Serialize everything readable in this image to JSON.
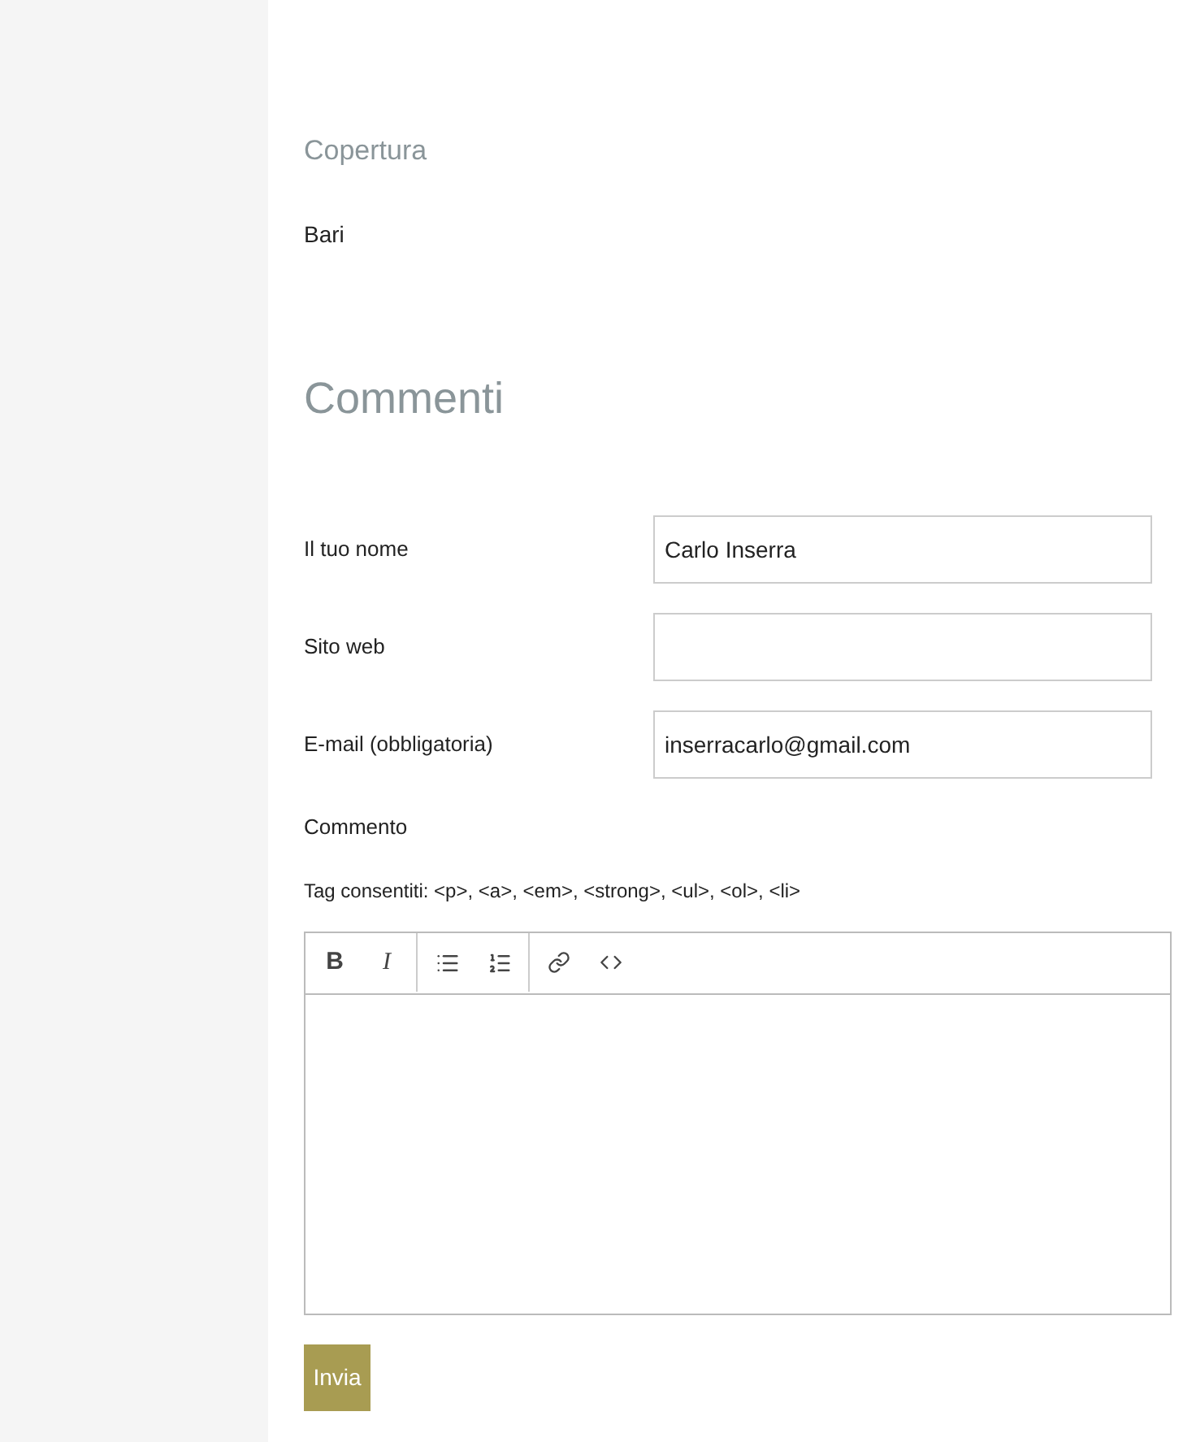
{
  "coverage": {
    "heading": "Copertura",
    "value": "Bari"
  },
  "comments": {
    "heading": "Commenti",
    "fields": [
      {
        "label": "Il tuo nome",
        "value": "Carlo Inserra"
      },
      {
        "label": "Sito web"
      },
      {
        "label": "E-mail (obbligatoria)",
        "value": "inserracarlo@gmail.com"
      }
    ],
    "comment_label": "Commento",
    "allowed_tags": "Tag consentiti: <p>, <a>, <em>, <strong>, <ul>, <ol>, <li>",
    "toolbar": [
      {
        "kind": "bold",
        "label": "B"
      },
      {
        "kind": "italic",
        "label": "I"
      },
      {
        "kind": "bullets"
      },
      {
        "kind": "numbers"
      },
      {
        "kind": "link"
      },
      {
        "kind": "code"
      }
    ],
    "submit": "Invia"
  }
}
